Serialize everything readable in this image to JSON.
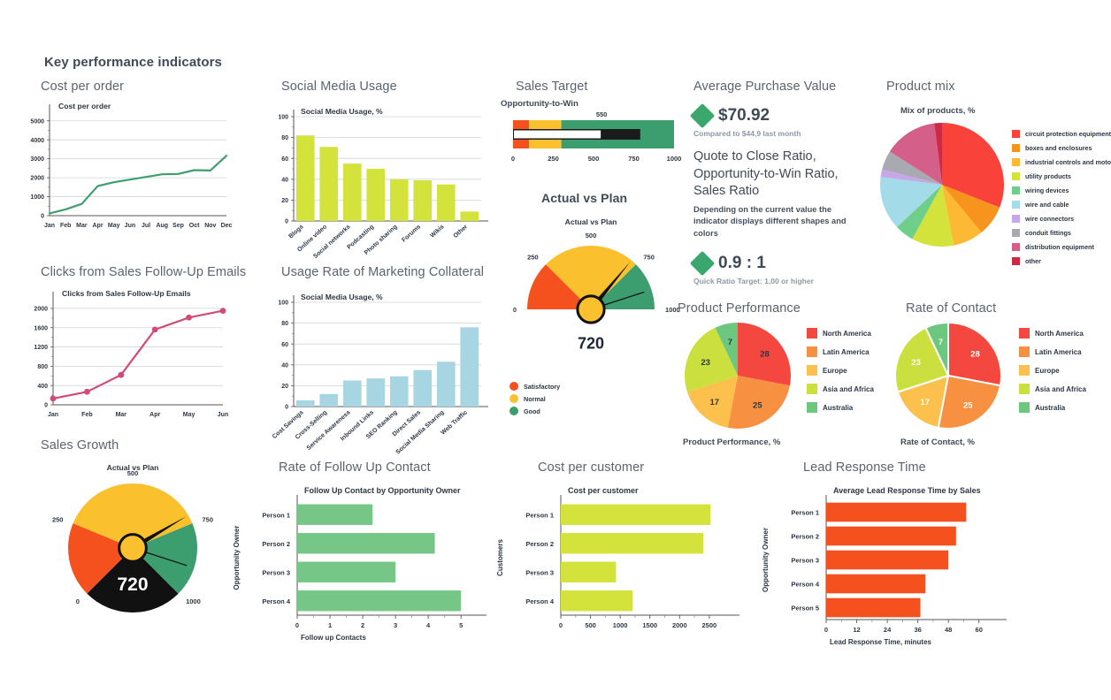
{
  "dashboard": {
    "title": "Key performance indicators"
  },
  "panels": {
    "cost_per_order": {
      "title": "Cost per order"
    },
    "social_media": {
      "title": "Social Media Usage"
    },
    "sales_target": {
      "title": "Sales Target"
    },
    "avg_purchase": {
      "title": "Average Purchase Value"
    },
    "product_mix": {
      "title": "Product mix"
    },
    "clicks": {
      "title": "Clicks from Sales Follow-Up Emails"
    },
    "usage_rate": {
      "title": "Usage Rate of Marketing Collateral"
    },
    "actual_vs_plan": {
      "title": "Actual vs Plan"
    },
    "product_performance": {
      "title": "Product Performance"
    },
    "rate_of_contact": {
      "title": "Rate of Contact"
    },
    "sales_growth": {
      "title": "Sales Growth"
    },
    "follow_up": {
      "title": "Rate of Follow Up Contact"
    },
    "cost_per_customer": {
      "title": "Cost per customer"
    },
    "lead_response": {
      "title": "Lead Response Time"
    }
  },
  "kpi": {
    "value": "$70.92",
    "compare": "Compared to $44,9 last month",
    "heading": "Quote to Close Ratio, Opportunity-to-Win Ratio, Sales Ratio",
    "description": "Depending on the current value the indicator displays different shapes and colors",
    "ratio_value": "0.9 : 1",
    "ratio_sub": "Quick Ratio Target: 1,00 or higher",
    "shape_color": "#3aa76d"
  },
  "chart_data": [
    {
      "id": "cost_per_order",
      "type": "line",
      "title": "Cost per order",
      "xlabel": "",
      "ylabel": "",
      "categories": [
        "Jan",
        "Feb",
        "Mar",
        "Apr",
        "May",
        "Jun",
        "Jul",
        "Aug",
        "Sep",
        "Oct",
        "Nov",
        "Dec"
      ],
      "values": [
        120,
        330,
        620,
        1560,
        1760,
        1900,
        2040,
        2180,
        2200,
        2400,
        2380,
        3160
      ],
      "ylim": [
        0,
        5500
      ],
      "yticks": [
        0,
        1000,
        2000,
        3000,
        4000,
        5000
      ],
      "color": "#3f9e6d",
      "grid": true
    },
    {
      "id": "social_media",
      "type": "bar",
      "title": "Social Media Usage, %",
      "xlabel": "",
      "ylabel": "",
      "categories": [
        "Blogs",
        "Online video",
        "Social networks",
        "Podcasting",
        "Photo sharing",
        "Forums",
        "Wikis",
        "Other"
      ],
      "values": [
        82,
        71,
        55,
        50,
        40,
        39,
        35,
        9
      ],
      "ylim": [
        0,
        100
      ],
      "yticks": [
        0,
        20,
        40,
        60,
        80,
        100
      ],
      "color": "#d4e23c",
      "grid": true
    },
    {
      "id": "sales_target",
      "type": "bullet",
      "title": "Opportunity-to-Win",
      "target_label": "550",
      "target": 550,
      "actual": 790,
      "ranges": [
        {
          "from": 0,
          "to": 100,
          "color": "#f4511e"
        },
        {
          "from": 100,
          "to": 300,
          "color": "#fbc02d"
        },
        {
          "from": 300,
          "to": 1000,
          "color": "#3c9d6e"
        }
      ],
      "xlim": [
        0,
        1000
      ],
      "xticks": [
        0,
        250,
        500,
        750,
        1000
      ]
    },
    {
      "id": "product_mix",
      "type": "pie",
      "title": "Mix of products, %",
      "categories": [
        "circuit protection equipment",
        "boxes and enclosures",
        "industrial controls and motors",
        "utility products",
        "wiring devices",
        "wire and cable",
        "wire connectors",
        "conduit fittings",
        "distribution equipment",
        "other"
      ],
      "values": [
        31,
        8,
        8,
        11,
        5,
        14,
        2,
        5,
        14,
        2
      ],
      "colors": [
        "#f9423a",
        "#f7941e",
        "#fdb933",
        "#d4e23c",
        "#6fcf8a",
        "#a4dbe8",
        "#c6a8e8",
        "#a9a9b2",
        "#d4608a",
        "#cc2b43"
      ],
      "legend": "right"
    },
    {
      "id": "clicks",
      "type": "line",
      "title": "Clicks from Sales Follow-Up Emails",
      "xlabel": "",
      "ylabel": "",
      "categories": [
        "Jan",
        "Feb",
        "Mar",
        "Apr",
        "May",
        "Jun"
      ],
      "values": [
        130,
        270,
        620,
        1560,
        1810,
        1950
      ],
      "ylim": [
        0,
        2200
      ],
      "yticks": [
        0,
        400,
        800,
        1200,
        1600,
        2000
      ],
      "color": "#d14a79",
      "markers": true,
      "grid": true
    },
    {
      "id": "usage_rate",
      "type": "bar",
      "title": "Social Media Usage, %",
      "xlabel": "",
      "ylabel": "",
      "categories": [
        "Cost Savings",
        "Cross-Selling",
        "Service Awareness",
        "Inbound Links",
        "SEO Ranking",
        "Direct Sales",
        "Social Media Sharing",
        "Web Traffic"
      ],
      "values": [
        6,
        12,
        25,
        27,
        29,
        35,
        43,
        76
      ],
      "ylim": [
        0,
        100
      ],
      "yticks": [
        0,
        20,
        40,
        60,
        80,
        100
      ],
      "color": "#a8d5e2",
      "grid": true
    },
    {
      "id": "actual_vs_plan",
      "type": "gauge",
      "title": "Actual vs Plan",
      "value": 720,
      "value_label": "720",
      "min": 0,
      "max": 1000,
      "ticks": [
        "0",
        "250",
        "500",
        "750",
        "1000"
      ],
      "bands": [
        {
          "from": 0,
          "to": 250,
          "color": "#f4511e",
          "label": "Satisfactory"
        },
        {
          "from": 250,
          "to": 750,
          "color": "#fbc02d",
          "label": "Normal"
        },
        {
          "from": 750,
          "to": 1000,
          "color": "#3c9d6e",
          "label": "Good"
        }
      ],
      "legend": [
        "Satisfactory",
        "Normal",
        "Good"
      ],
      "legend_colors": [
        "#f4511e",
        "#fbc02d",
        "#3c9d6e"
      ]
    },
    {
      "id": "product_performance",
      "type": "pie",
      "title": "Product Performance, %",
      "categories": [
        "North America",
        "Latin America",
        "Europe",
        "Asia and Africa",
        "Australia"
      ],
      "values": [
        28,
        25,
        17,
        23,
        7
      ],
      "colors": [
        "#f4473f",
        "#f79141",
        "#fcc14d",
        "#cbe03f",
        "#6ec77f"
      ],
      "label_color": "#2c3744",
      "legend": "right"
    },
    {
      "id": "rate_of_contact",
      "type": "pie",
      "title": "Rate of Contact, %",
      "categories": [
        "North America",
        "Latin America",
        "Europe",
        "Asia and Africa",
        "Australia"
      ],
      "values": [
        28,
        25,
        17,
        23,
        7
      ],
      "colors": [
        "#f4473f",
        "#f79141",
        "#fcc14d",
        "#cbe03f",
        "#6ec77f"
      ],
      "label_color": "#ffffff",
      "legend": "right"
    },
    {
      "id": "sales_growth",
      "type": "gauge",
      "title": "Actual vs Plan",
      "value": 720,
      "value_label": "720",
      "min": 0,
      "max": 1000,
      "ticks": [
        "0",
        "250",
        "500",
        "750",
        "1000"
      ],
      "bands": [
        {
          "from": 0,
          "to": 250,
          "color": "#f4511e"
        },
        {
          "from": 250,
          "to": 750,
          "color": "#fbc02d"
        },
        {
          "from": 750,
          "to": 1000,
          "color": "#3c9d6e"
        }
      ],
      "base_color": "#111111",
      "value_color": "#ffffff"
    },
    {
      "id": "follow_up",
      "type": "bar_horizontal",
      "title": "Follow Up Contact by Opportunity Owner",
      "xlabel": "Follow up Contacts",
      "ylabel": "Opportunity Owner",
      "categories": [
        "Person 1",
        "Person 2",
        "Person 3",
        "Person 4"
      ],
      "values": [
        2.3,
        4.2,
        3.0,
        5.0
      ],
      "xlim": [
        0,
        5.4
      ],
      "xticks": [
        0,
        1,
        2,
        3,
        4,
        5
      ],
      "color": "#76c787"
    },
    {
      "id": "cost_per_customer",
      "type": "bar_horizontal",
      "title": "Cost per customer",
      "xlabel": "",
      "ylabel": "Customers",
      "categories": [
        "Person 1",
        "Person 2",
        "Person 3",
        "Person 4"
      ],
      "values": [
        2520,
        2400,
        930,
        1210
      ],
      "xlim": [
        0,
        2800
      ],
      "xticks": [
        0,
        500,
        1000,
        1500,
        2000,
        2500
      ],
      "color": "#d4e23c"
    },
    {
      "id": "lead_response",
      "type": "bar_horizontal",
      "title": "Average Lead Response Time by Sales",
      "xlabel": "Lead Response Time, minutes",
      "ylabel": "Opportunity Owner",
      "categories": [
        "Person 1",
        "Person 2",
        "Person 3",
        "Person 4",
        "Person 5"
      ],
      "values": [
        55,
        51,
        48,
        39,
        37
      ],
      "xlim": [
        0,
        66
      ],
      "xticks": [
        0,
        12,
        24,
        36,
        48,
        60
      ],
      "color": "#f4511e"
    }
  ]
}
